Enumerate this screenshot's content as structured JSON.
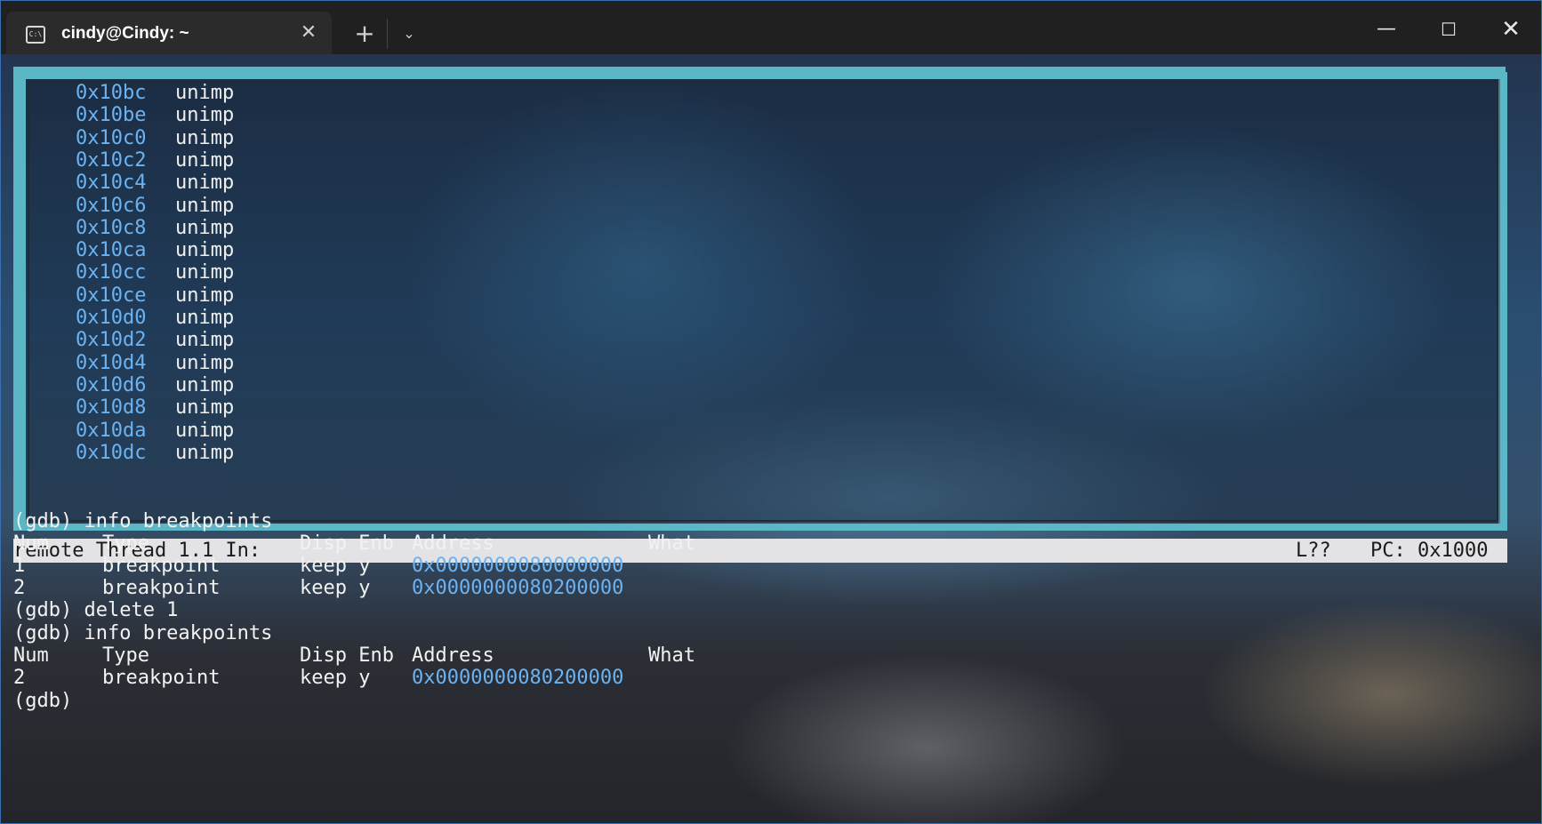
{
  "window": {
    "tab_title": "cindy@Cindy: ~",
    "tab_icon_text": "C:\\",
    "close_tab": "✕",
    "new_tab": "+",
    "dropdown": "⌄",
    "minimize": "—",
    "maximize": "☐",
    "close": "✕"
  },
  "asm": {
    "rows": [
      {
        "addr": "0x10bc",
        "instr": "unimp"
      },
      {
        "addr": "0x10be",
        "instr": "unimp"
      },
      {
        "addr": "0x10c0",
        "instr": "unimp"
      },
      {
        "addr": "0x10c2",
        "instr": "unimp"
      },
      {
        "addr": "0x10c4",
        "instr": "unimp"
      },
      {
        "addr": "0x10c6",
        "instr": "unimp"
      },
      {
        "addr": "0x10c8",
        "instr": "unimp"
      },
      {
        "addr": "0x10ca",
        "instr": "unimp"
      },
      {
        "addr": "0x10cc",
        "instr": "unimp"
      },
      {
        "addr": "0x10ce",
        "instr": "unimp"
      },
      {
        "addr": "0x10d0",
        "instr": "unimp"
      },
      {
        "addr": "0x10d2",
        "instr": "unimp"
      },
      {
        "addr": "0x10d4",
        "instr": "unimp"
      },
      {
        "addr": "0x10d6",
        "instr": "unimp"
      },
      {
        "addr": "0x10d8",
        "instr": "unimp"
      },
      {
        "addr": "0x10da",
        "instr": "unimp"
      },
      {
        "addr": "0x10dc",
        "instr": "unimp"
      }
    ]
  },
  "status": {
    "left": "remote Thread 1.1 In:",
    "line": "L??",
    "pc": "PC: 0x1000"
  },
  "console": {
    "cmd1": "(gdb) info breakpoints",
    "header1": {
      "num": "Num",
      "type": "Type",
      "disp_enb": "Disp Enb",
      "address": "Address",
      "what": "What"
    },
    "bp1": {
      "num": "1",
      "type": "breakpoint",
      "disp": "keep y",
      "address": "0x0000000080000000"
    },
    "bp2": {
      "num": "2",
      "type": "breakpoint",
      "disp": "keep y",
      "address": "0x0000000080200000"
    },
    "cmd2": "(gdb) delete 1",
    "cmd3": "(gdb) info breakpoints",
    "header2": {
      "num": "Num",
      "type": "Type",
      "disp_enb": "Disp Enb",
      "address": "Address",
      "what": "What"
    },
    "bp3": {
      "num": "2",
      "type": "breakpoint",
      "disp": "keep y",
      "address": "0x0000000080200000"
    },
    "prompt": "(gdb)"
  },
  "colors": {
    "frame": "#5bb7c6",
    "address": "#6bb3f2",
    "statusbar": "#e3e3e6"
  }
}
